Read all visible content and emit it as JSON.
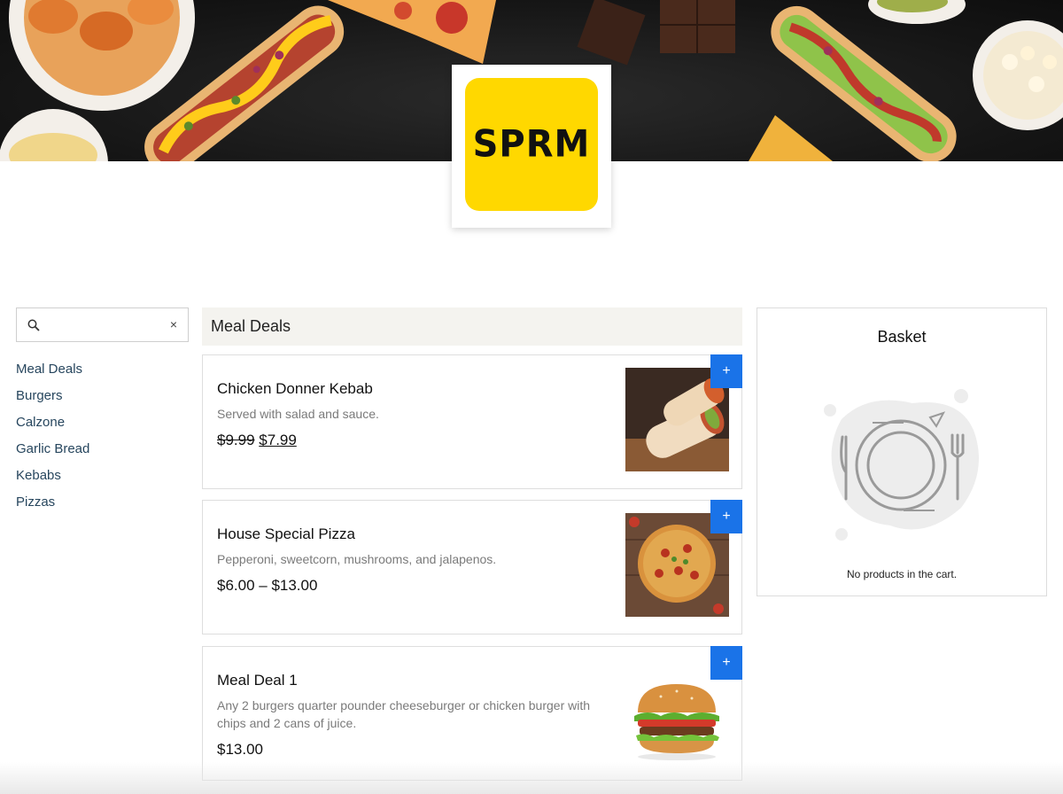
{
  "brand": {
    "logo_text": "SPRM",
    "accent": "#ffd800",
    "button_color": "#1a73e8"
  },
  "search": {
    "value": "",
    "placeholder": "",
    "clear_label": "×"
  },
  "categories": [
    "Meal Deals",
    "Burgers",
    "Calzone",
    "Garlic Bread",
    "Kebabs",
    "Pizzas"
  ],
  "section": {
    "title": "Meal Deals"
  },
  "products": [
    {
      "name": "Chicken Donner Kebab",
      "description": "Served with salad and sauce.",
      "old_price": "$9.99",
      "price": "$7.99",
      "image": "kebab-wrap-image",
      "add_label": "+"
    },
    {
      "name": "House Special Pizza",
      "description": "Pepperoni, sweetcorn, mushrooms, and jalapenos.",
      "price": "$6.00 – $13.00",
      "image": "pizza-image",
      "add_label": "+"
    },
    {
      "name": "Meal Deal 1",
      "description": "Any 2 burgers quarter pounder cheeseburger or chicken burger with chips and 2 cans of juice.",
      "price": "$13.00",
      "image": "burger-image",
      "add_label": "+"
    }
  ],
  "basket": {
    "title": "Basket",
    "empty_text": "No products in the cart.",
    "icon": "plate-cutlery-icon"
  }
}
